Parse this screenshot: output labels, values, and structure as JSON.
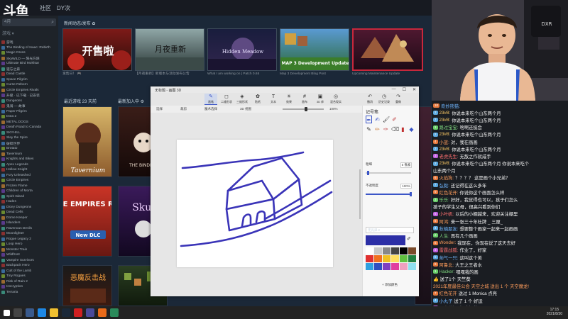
{
  "steam": {
    "logo": "斗鱼",
    "nav": [
      "社区",
      "DY次",
      "庆"
    ],
    "search_text": "4月",
    "filter_label": "游戏 ▾",
    "featured_title": "新闻动态/发布 ✿",
    "recent_title": "最近游戏 23 天前",
    "shelf_title": "最新加入中 ⚙",
    "featured": [
      {
        "label": "",
        "caption": "发售日！ 🎮",
        "art": "开售啦"
      },
      {
        "label": "",
        "caption": "【月夜重新】新版本与活动发布公告",
        "art": "月夜重新"
      },
      {
        "label": "",
        "caption": "What I am working on | Patch 0.65",
        "art": "Hidden Meadow"
      },
      {
        "label": "",
        "caption": "Map 3 Development Blog Post",
        "art": "MAP 3 Development Update"
      },
      {
        "label": "",
        "caption": "Upcoming Maintenance Update",
        "art": ""
      }
    ],
    "tiles": [
      {
        "art": "Tavernium"
      },
      {
        "art": "THE BINDING"
      },
      {
        "art": "CIRCLE EMPIRES RIVALS",
        "sub": "New DLC"
      },
      {
        "art": "Skul"
      },
      {
        "art": "恶魔反击战"
      },
      {
        "art": ""
      }
    ],
    "library": [
      "游戏",
      "The Binding of Isaac: Rebirth",
      "Magic Dress",
      "SkyWILD — 阳光方跃",
      "Ultimate Bird Mokhtar",
      "遗忘之森",
      "Dead Castle",
      "Space Pilgrim",
      "Curse Reborn",
      "Circle Empires Rivals",
      "升级 · 已下载 · 已安装",
      "Dungeons",
      "鬼骑 — 故事",
      "Paper Pilgrim",
      "Dota 2",
      "METAL DOGS",
      "Death Road to Canada",
      "SKYHILL",
      "Slay the Spire",
      "破碎世界",
      "Brotato",
      "Tavernium",
      "Knights and Bikes",
      "Apex Legends",
      "Hollow Knight",
      "Fury Unleashed",
      "Circle Empires",
      "Frozen Flame",
      "Children of Morta",
      "Spirit Island",
      "Hades",
      "Dicey Dungeons",
      "Dead Cells",
      "Dome Keeper",
      "Islanders",
      "Ravenous Devils",
      "Moonlighter",
      "Rogue Legacy 2",
      "Loop Hero",
      "Monster Train",
      "Wildfrost",
      "Vampire Survivors",
      "Backpack Hero",
      "Cult of the Lamb",
      "Tiny Rogues",
      "Risk of Rain 2",
      "Inscryption",
      "Terraria"
    ]
  },
  "paint": {
    "title": "无标题 - 画图 3D",
    "controls": [
      "—",
      "☐",
      "✕"
    ],
    "ribbon": [
      "画笔",
      "二维形状",
      "三维形状",
      "贴纸",
      "文本",
      "效果",
      "画布",
      "3D 库",
      "混合现实",
      "撤消",
      "历史记录",
      "重做"
    ],
    "subbar": [
      "选择",
      "裁剪",
      "魔术选择",
      "3D 视图"
    ],
    "zoom": "100%",
    "panel": {
      "title": "记号笔",
      "thickness_label": "粗细",
      "thickness_value": "5 像素",
      "opacity_label": "不透明度",
      "opacity_value": "100%",
      "color_mode": "无光泽",
      "add_color": "+ 添加颜色"
    },
    "current_color": "#2c2fa6",
    "swatches": [
      "#ffffff",
      "#c8c8c8",
      "#888888",
      "#444444",
      "#000000",
      "#7a4a2a",
      "#e03030",
      "#f07020",
      "#f0c020",
      "#ffe060",
      "#60c040",
      "#208040",
      "#30a0e0",
      "#3050c0",
      "#8040c0",
      "#e040a0",
      "#f0a0c0",
      "#90e0f0"
    ]
  },
  "chat": [
    {
      "badge": "10",
      "badge_color": "#e6783c",
      "name": "奇妙熊猫:",
      "name_color": "#6fb6ff",
      "text": ""
    },
    {
      "badge": "2",
      "badge_color": "#5aa8e0",
      "name": "23#8:",
      "name_color": "#ffcc66",
      "text": "你说本来吃个山东两个月"
    },
    {
      "badge": "2",
      "badge_color": "#5aa8e0",
      "name": "23#8:",
      "name_color": "#ffcc66",
      "text": "你说本来吃个山东两个月"
    },
    {
      "badge": "1",
      "badge_color": "#6ad06a",
      "name": "路过宝宝:",
      "name_color": "#7fd87f",
      "text": "啥啊还挺会"
    },
    {
      "badge": "2",
      "badge_color": "#5aa8e0",
      "name": "23#8:",
      "name_color": "#ffcc66",
      "text": "你说本来吃个山东两个月"
    },
    {
      "badge": "4",
      "badge_color": "#e6783c",
      "name": "小蓝:",
      "name_color": "#ff9d5c",
      "text": "对，我在画画"
    },
    {
      "badge": "2",
      "badge_color": "#5aa8e0",
      "name": "23#8:",
      "name_color": "#ffcc66",
      "text": "你说本来吃个山东两个月"
    },
    {
      "badge": "3",
      "badge_color": "#c060e0",
      "name": "老虎先生:",
      "name_color": "#ff7070",
      "text": "无敌之作就咸手"
    },
    {
      "badge": "2",
      "badge_color": "#5aa8e0",
      "name": "23#8:",
      "name_color": "#ffcc66",
      "text": "你说本来吃个山东两个月 你说本来吃个"
    },
    {
      "badge": "",
      "badge_color": "#000000",
      "name": "",
      "name_color": "#ffffff",
      "text": "山东两个月"
    },
    {
      "badge": "6",
      "badge_color": "#e6783c",
      "name": "火焰狗:",
      "name_color": "#ff9d5c",
      "text": "？？？？ 这是画个小兄弟？"
    },
    {
      "badge": "7",
      "badge_color": "#5aa8e0",
      "name": "弘毅:",
      "name_color": "#6fb6ff",
      "text": "还记得在这么多年"
    },
    {
      "badge": "9",
      "badge_color": "#e6783c",
      "name": "红色花开:",
      "name_color": "#ff9d5c",
      "text": "你说你这个画面怎么样"
    },
    {
      "badge": "3",
      "badge_color": "#6ad06a",
      "name": "乐乐:",
      "name_color": "#7fd87f",
      "text": "好好，我觉得也可以，孩子们怎么"
    },
    {
      "badge": "",
      "badge_color": "#000000",
      "name": "",
      "name_color": "#ffffff",
      "text": "孩子的学生父母，很高兴看到你们"
    },
    {
      "badge": "5",
      "badge_color": "#c060e0",
      "name": "小叶帆:",
      "name_color": "#ff7070",
      "text": "以后的小棚越来，欢迎关注棚里"
    },
    {
      "badge": "8",
      "badge_color": "#e6783c",
      "name": "阿鸿:",
      "name_color": "#ff9d5c",
      "text": "来一张三十年杜牌 _ 三厘_"
    },
    {
      "badge": "4",
      "badge_color": "#5aa8e0",
      "name": "秋楠朋友:",
      "name_color": "#6fb6ff",
      "text": "想要整个画家一起来一起画画"
    },
    {
      "badge": "2",
      "badge_color": "#6ad06a",
      "name": "人生:",
      "name_color": "#7fd87f",
      "text": "再有几个画画"
    },
    {
      "badge": "6",
      "badge_color": "#e6783c",
      "name": "Wonder:",
      "name_color": "#ff9d5c",
      "text": "我现在，你现在说了这天去好"
    },
    {
      "badge": "3",
      "badge_color": "#c060e0",
      "name": "雷霆战狐:",
      "name_color": "#ff7070",
      "text": "作业了，好家"
    },
    {
      "badge": "5",
      "badge_color": "#5aa8e0",
      "name": "帅气一只:",
      "name_color": "#6fb6ff",
      "text": "这叫这个美"
    },
    {
      "badge": "9",
      "badge_color": "#e6783c",
      "name": "阿鲁北:",
      "name_color": "#ff9d5c",
      "text": "大王之王者水"
    },
    {
      "badge": "1",
      "badge_color": "#6ad06a",
      "name": "Hacker:",
      "name_color": "#7fd87f",
      "text": "嘿嘿我的画"
    },
    {
      "badge": "",
      "badge_color": "#000000",
      "name": "",
      "name_color": "#ffffff",
      "text": "👍 送了1个 天竺葵"
    },
    {
      "badge": "",
      "badge_color": "#000000",
      "name": "",
      "name_color": "#ff9d5c",
      "text": "2021年度最佳公会 天空之城 送出 1 个 天空魔龙!"
    },
    {
      "badge": "7",
      "badge_color": "#e6783c",
      "name": "红色花开",
      "name_color": "#ff9d5c",
      "text": "送过 1 Monica 点亮"
    },
    {
      "badge": "4",
      "badge_color": "#5aa8e0",
      "name": "小丸子",
      "name_color": "#6fb6ff",
      "text": "送了 1 个 好运"
    },
    {
      "badge": "8",
      "badge_color": "#c060e0",
      "name": "阿宝",
      "name_color": "#ffcc66",
      "text": "送了来 啥好菜"
    },
    {
      "badge": "3",
      "badge_color": "#6ad06a",
      "name": "老李",
      "name_color": "#7fd87f",
      "text": "感谢 送了 1 个"
    },
    {
      "badge": "6",
      "badge_color": "#e6783c",
      "name": "你们",
      "name_color": "#ff9d5c",
      "text": "送了 1 个 喜欢"
    },
    {
      "badge": "2",
      "badge_color": "#5aa8e0",
      "name": "泡泡",
      "name_color": "#ffcc66",
      "text": "送了 1 个 粉丝荧光棒"
    }
  ],
  "taskbar": {
    "time": "17:15",
    "date": "2021/8/30"
  }
}
